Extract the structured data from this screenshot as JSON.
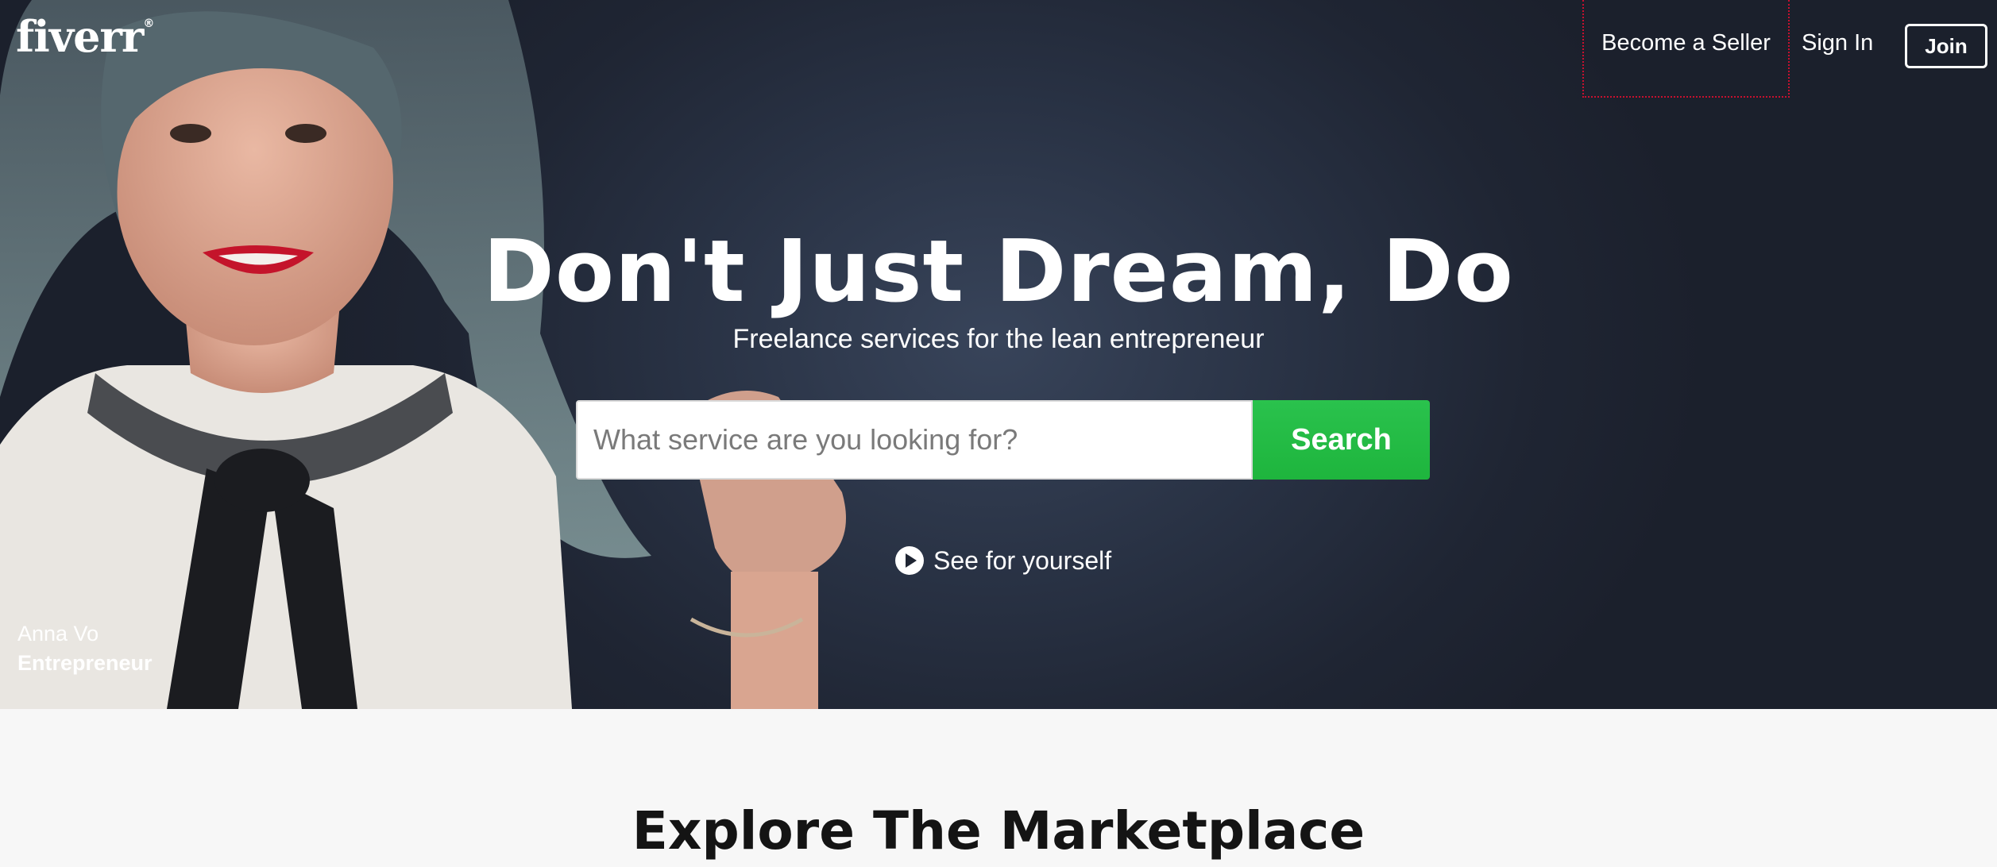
{
  "brand": {
    "logo_text": "fiverr",
    "registered_mark": "®"
  },
  "nav": {
    "become_seller": "Become a Seller",
    "sign_in": "Sign In",
    "join": "Join"
  },
  "hero": {
    "headline": "Don't Just Dream, Do",
    "subheadline": "Freelance services for the lean entrepreneur",
    "search": {
      "placeholder": "What service are you looking for?",
      "value": "",
      "button_label": "Search"
    },
    "video_link": "See for yourself",
    "caption": {
      "name": "Anna Vo",
      "role": "Entrepreneur"
    },
    "icons": {
      "play": "play-circle-icon"
    }
  },
  "section": {
    "explore_title": "Explore The Marketplace"
  },
  "colors": {
    "hero_bg": "#1f2533",
    "search_button": "#1eb53d",
    "text_light": "#ffffff",
    "page_bg": "#f7f7f7",
    "section_title": "#141414"
  }
}
